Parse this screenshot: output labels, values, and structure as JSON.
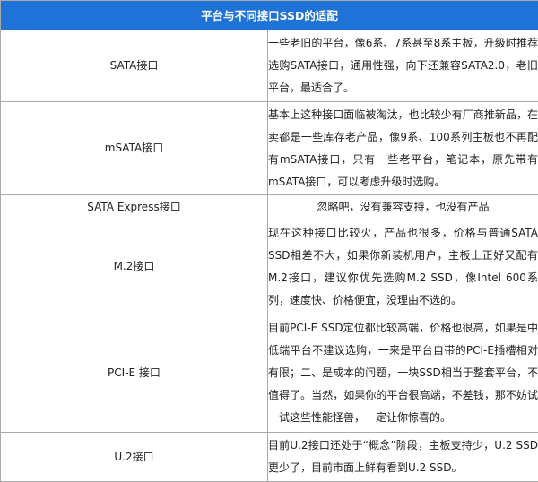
{
  "table": {
    "title": "平台与不同接口SSD的适配",
    "rows": [
      {
        "interface": "SATA接口",
        "description": "一些老旧的平台，像6系、7系甚至8系主板，升级时推荐选购SATA接口，通用性强，向下还兼容SATA2.0，老旧平台，最适合了。"
      },
      {
        "interface": "mSATA接口",
        "description": "基本上这种接口面临被淘汰，也比较少有厂商推新品，在卖都是一些库存老产品，像9系、100系列主板也不再配有mSATA接口，只有一些老平台，笔记本，原先带有mSATA接口，可以考虑升级时选购。"
      },
      {
        "interface": "SATA Express接口",
        "description": "忽略吧，没有兼容支持，也没有产品"
      },
      {
        "interface": "M.2接口",
        "description": "现在这种接口比较火，产品也很多，价格与普通SATA SSD相差不大，如果你新装机用户，主板上正好又配有M.2接口，建议你优先选购M.2 SSD，像Intel 600系列，速度快、价格便宜，没理由不选的。"
      },
      {
        "interface": "PCI-E 接口",
        "description": "目前PCI-E SSD定位都比较高端，价格也很高，如果是中低端平台不建议选购，一来是平台自带的PCI-E插槽相对有限；二、是成本的问题，一块SSD相当于整套平台，不值得了。当然，如果你的平台很高端，不差钱，那不妨试一试这些性能怪兽，一定让你惊喜的。"
      },
      {
        "interface": "U.2接口",
        "description": "目前U.2接口还处于“概念”阶段，主板支持少，U.2 SSD更少了，目前市面上鲜有看到U.2 SSD。"
      }
    ]
  }
}
